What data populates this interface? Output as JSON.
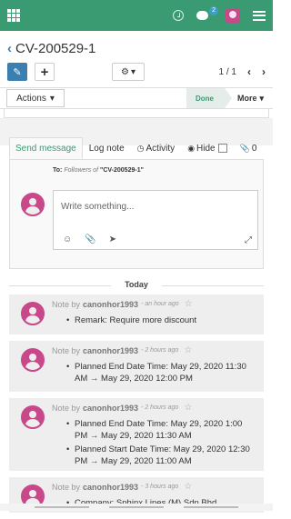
{
  "topbar": {
    "chat_badge": "2"
  },
  "record": {
    "title": "CV-200529-1"
  },
  "control": {
    "create_label": "+",
    "pager": "1 / 1"
  },
  "statusbar": {
    "actions_label": "Actions",
    "stage_label": "Done",
    "more_label": "More"
  },
  "chatter": {
    "tabs": {
      "send_message": "Send message",
      "log_note": "Log note",
      "activity": "Activity",
      "hide": "Hide",
      "followers_count": "0"
    },
    "to_prefix": "To:",
    "to_followers": "Followers of",
    "to_record": "\"CV-200529-1\"",
    "composer_placeholder": "Write something..."
  },
  "day_separator": "Today",
  "messages": [
    {
      "type": "Note by",
      "author": "canonhor1993",
      "time": "- an hour ago",
      "lines": [
        "Remark: Require more discount"
      ]
    },
    {
      "type": "Note by",
      "author": "canonhor1993",
      "time": "- 2 hours ago",
      "lines": [
        "Planned End Date Time: May 29, 2020 11:30 AM → May 29, 2020 12:00 PM"
      ]
    },
    {
      "type": "Note by",
      "author": "canonhor1993",
      "time": "- 2 hours ago",
      "lines": [
        "Planned End Date Time: May 29, 2020 1:00 PM → May 29, 2020 11:30 AM",
        "Planned Start Date Time: May 29, 2020 12:30 PM → May 29, 2020 11:00 AM"
      ]
    },
    {
      "type": "Note by",
      "author": "canonhor1993",
      "time": "- 3 hours ago",
      "lines": [
        "Company: Sphinx Lines (M) Sdn Bhd"
      ]
    }
  ],
  "colors": {
    "brand": "#3a9b73",
    "primary": "#3a7fb0",
    "avatar": "#c8488a"
  }
}
